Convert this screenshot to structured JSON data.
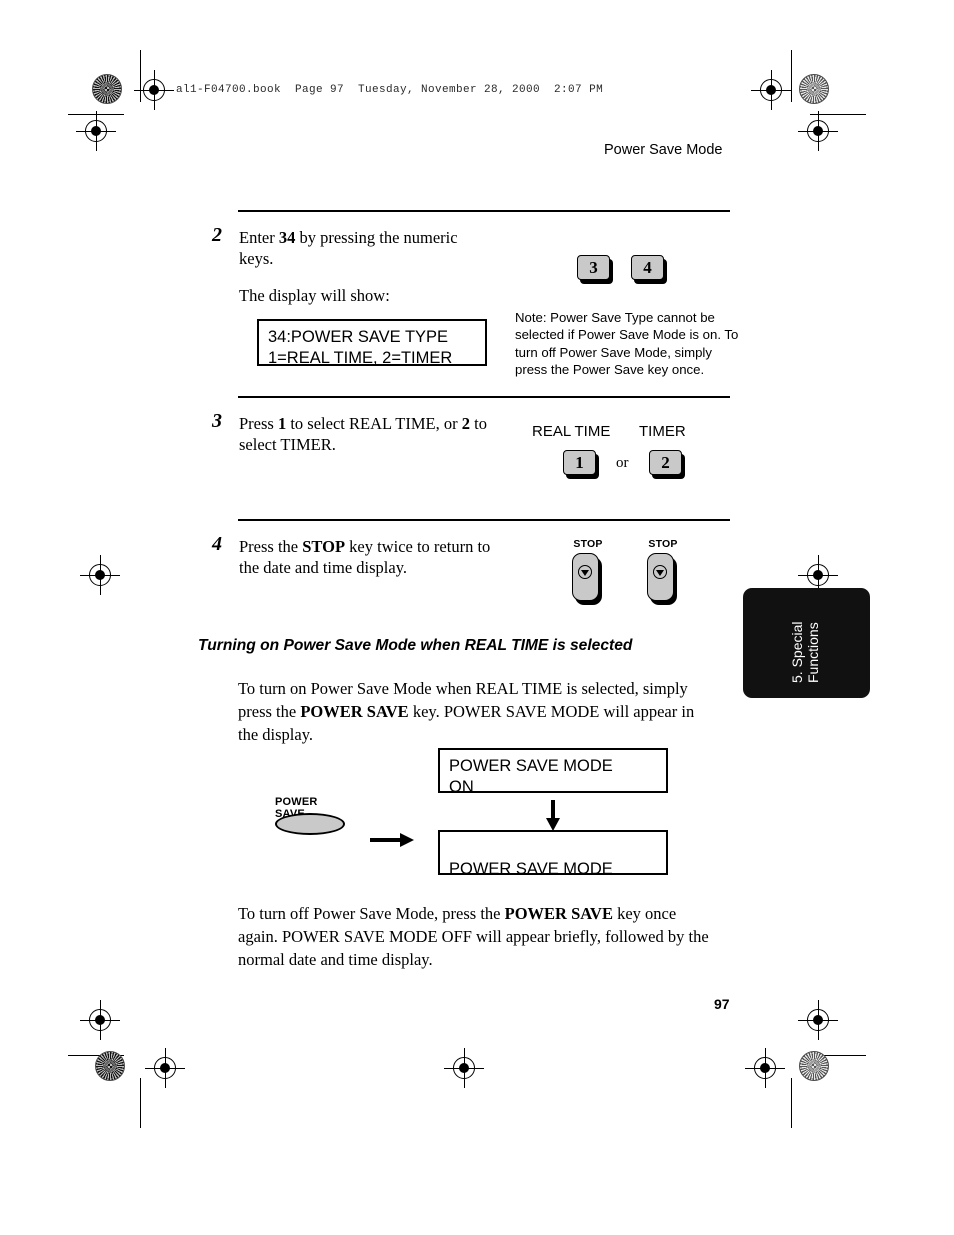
{
  "page": {
    "book_line": "al1-F04700.book  Page 97  Tuesday, November 28, 2000  2:07 PM",
    "running_head": "Power Save Mode",
    "page_number": "97"
  },
  "chapter_tab": {
    "line1": "5. Special",
    "line2": "Functions"
  },
  "steps": [
    {
      "number": "2",
      "text_html": "Enter <b>34</b> by pressing the numeric keys.",
      "followup": "The display will show:",
      "keys": [
        "3",
        "4"
      ],
      "lcd": "34:POWER SAVE TYPE\n1=REAL TIME, 2=TIMER",
      "note": "Note: Power Save Type cannot be selected if Power Save Mode is on. To turn off Power Save Mode, simply press the Power Save key once."
    },
    {
      "number": "3",
      "text_html": "Press <b>1</b> to select REAL TIME, or <b>2</b> to select TIMER.",
      "option_labels": [
        "REAL TIME",
        "TIMER"
      ],
      "keys": [
        "1",
        "2"
      ],
      "conjunction": "or"
    },
    {
      "number": "4",
      "text_html": "Press the <b>STOP</b> key twice to return to the date and time display.",
      "stop_keys": [
        "STOP",
        "STOP"
      ]
    }
  ],
  "section": {
    "heading": "Turning on Power Save Mode when REAL TIME is selected",
    "paragraph_1_html": "To turn on Power Save Mode when REAL TIME is selected, simply press the <b>POWER SAVE</b> key. POWER SAVE MODE will appear in the display.",
    "paragraph_2_html": "To turn off Power Save Mode, press the <b>POWER SAVE</b> key once again. POWER SAVE MODE OFF will appear briefly, followed by the normal date and time display.",
    "power_save_key_label": "POWER SAVE",
    "display_1": "POWER SAVE MODE\nON",
    "display_2": "\nPOWER SAVE MODE"
  }
}
